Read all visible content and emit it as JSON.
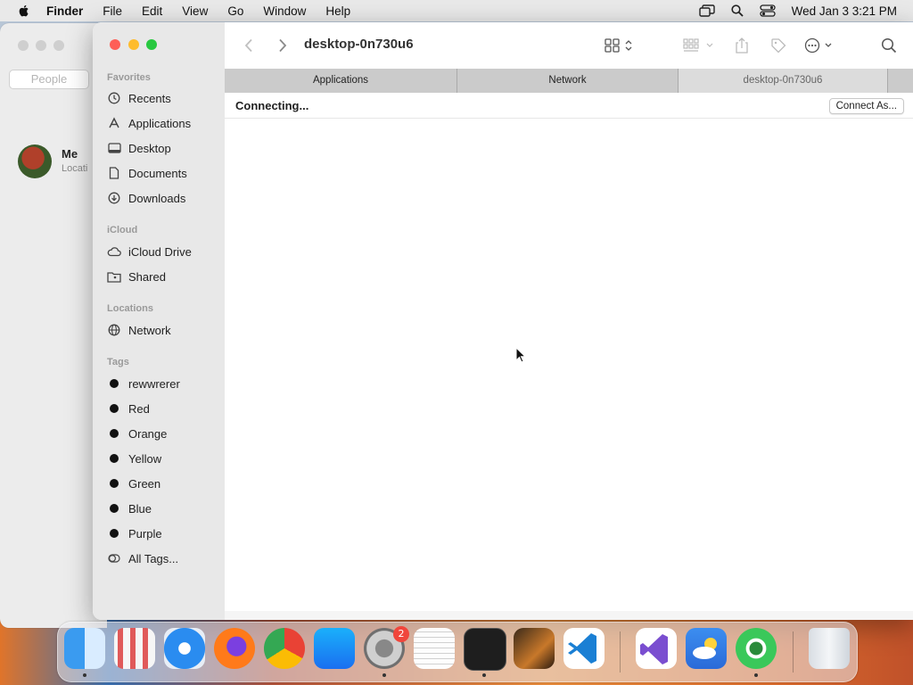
{
  "menubar": {
    "app_name": "Finder",
    "items": [
      "File",
      "Edit",
      "View",
      "Go",
      "Window",
      "Help"
    ],
    "datetime": "Wed Jan 3  3:21 PM"
  },
  "contacts_window": {
    "search_placeholder": "People",
    "me_name": "Me",
    "me_sub": "Locati"
  },
  "finder": {
    "title": "desktop-0n730u6",
    "sidebar": {
      "favorites_header": "Favorites",
      "favorites": [
        {
          "label": "Recents",
          "icon": "clock-icon"
        },
        {
          "label": "Applications",
          "icon": "applications-icon"
        },
        {
          "label": "Desktop",
          "icon": "desktop-icon"
        },
        {
          "label": "Documents",
          "icon": "document-icon"
        },
        {
          "label": "Downloads",
          "icon": "download-icon"
        }
      ],
      "icloud_header": "iCloud",
      "icloud": [
        {
          "label": "iCloud Drive",
          "icon": "cloud-icon"
        },
        {
          "label": "Shared",
          "icon": "shared-folder-icon"
        }
      ],
      "locations_header": "Locations",
      "locations": [
        {
          "label": "Network",
          "icon": "globe-icon"
        }
      ],
      "tags_header": "Tags",
      "tags": [
        "rewwrerer",
        "Red",
        "Orange",
        "Yellow",
        "Green",
        "Blue",
        "Purple"
      ],
      "all_tags": "All Tags..."
    },
    "pathbar": [
      "Applications",
      "Network",
      "desktop-0n730u6"
    ],
    "status_text": "Connecting...",
    "connect_button": "Connect As..."
  },
  "dock": {
    "apps": [
      "Finder",
      "Launchpad",
      "Safari",
      "Firefox",
      "Chrome",
      "App Store",
      "System Preferences",
      "TextEdit",
      "Terminal",
      "GarageBand",
      "Visual Studio Code",
      "Visual Studio",
      "Weather",
      "Find My",
      "Trash"
    ],
    "settings_badge": "2"
  },
  "colors": {
    "close": "#fe5f57",
    "minimize": "#febc2e",
    "zoom": "#28c840"
  }
}
